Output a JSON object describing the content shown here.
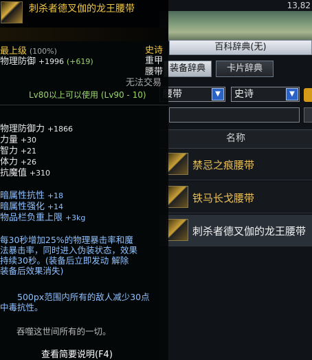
{
  "background_window": {
    "counter": "13,82",
    "title": "百科辞典(无)",
    "tabs": [
      "装备辞典",
      "卡片辞典"
    ],
    "part_select": "腰带",
    "rarity_select": "史诗",
    "column_header": "名称",
    "rows": [
      {
        "name": "禁忌之痕腰带"
      },
      {
        "name": "铁马长戈腰带"
      },
      {
        "name": "刺杀者德叉伽的龙王腰带"
      }
    ]
  },
  "tooltip": {
    "title": "刺杀者德叉伽的龙王腰带",
    "grade": "最上级",
    "grade_pct": "(100%)",
    "rarity": "史诗",
    "phys_def_label": "物理防御",
    "phys_def_value": "+1996",
    "phys_def_bonus": "(+619)",
    "armor_type": "重甲",
    "slot": "腰带",
    "trade": "无法交易",
    "level_req": "Lv80以上可以使用 (Lv90 - 10)",
    "stats": [
      {
        "label": "物理防御力",
        "value": "+1866"
      },
      {
        "label": "力量",
        "value": "+30"
      },
      {
        "label": "智力",
        "value": "+21"
      },
      {
        "label": "体力",
        "value": "+26"
      },
      {
        "label": "抗魔值",
        "value": "+310"
      }
    ],
    "stats2": [
      {
        "label": "暗属性抗性",
        "value": "+18"
      },
      {
        "label": "暗属性强化",
        "value": "+14"
      },
      {
        "label": "物品栏负重上限",
        "value": "+3kg"
      }
    ],
    "desc_lines": [
      "每30秒增加25%的物理暴击率和魔",
      "法暴击率，同时进入伪装状态，效果",
      "持续30秒。(装备后立即发动 解除",
      "装备后效果消失)"
    ],
    "desc2": "500px范围内所有的敌人减少30点中毒抗性。",
    "flavor": "吞噬这世间所有的一切。",
    "help": "查看简要说明(F4)"
  }
}
